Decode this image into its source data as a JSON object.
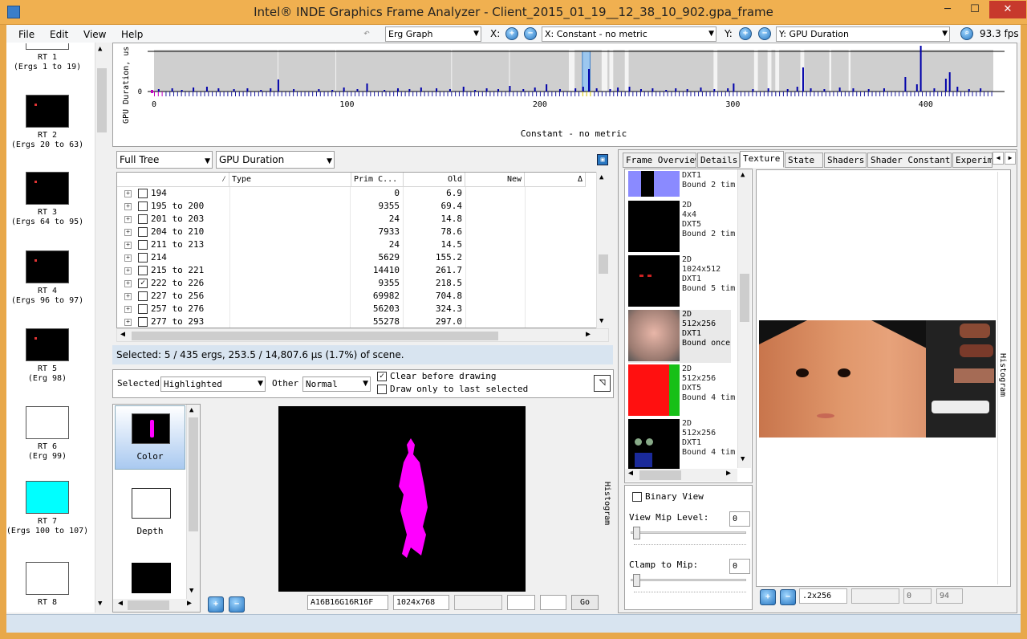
{
  "window": {
    "title": "Intel® INDE Graphics Frame Analyzer - Client_2015_01_19__12_38_10_902.gpa_frame",
    "min": "─",
    "max": "☐",
    "close": "✕"
  },
  "menu": [
    "File",
    "Edit",
    "View",
    "Help"
  ],
  "toolbar": {
    "graph_type": "Erg Graph",
    "x_label": "X:",
    "x_metric": "X: Constant - no metric",
    "y_label": "Y:",
    "y_metric": "Y: GPU Duration",
    "fps": "93.3 fps"
  },
  "chart_data": {
    "type": "bar",
    "ylabel": "GPU Duration, us",
    "xlabel": "Constant - no metric",
    "x_ticks": [
      0,
      100,
      200,
      300,
      400
    ],
    "y_ticks": [
      "0"
    ],
    "xlim": [
      0,
      435
    ],
    "highlight_range": [
      222,
      226
    ],
    "bars": [
      [
        2,
        3
      ],
      [
        9,
        4
      ],
      [
        14,
        2
      ],
      [
        20,
        5
      ],
      [
        27,
        6
      ],
      [
        33,
        4
      ],
      [
        41,
        3
      ],
      [
        48,
        4
      ],
      [
        55,
        2
      ],
      [
        60,
        4
      ],
      [
        64,
        15
      ],
      [
        72,
        3
      ],
      [
        85,
        3
      ],
      [
        92,
        2
      ],
      [
        98,
        5
      ],
      [
        105,
        3
      ],
      [
        110,
        10
      ],
      [
        119,
        2
      ],
      [
        126,
        4
      ],
      [
        132,
        3
      ],
      [
        138,
        5
      ],
      [
        146,
        4
      ],
      [
        153,
        3
      ],
      [
        160,
        6
      ],
      [
        166,
        2
      ],
      [
        172,
        4
      ],
      [
        178,
        3
      ],
      [
        184,
        7
      ],
      [
        191,
        3
      ],
      [
        197,
        5
      ],
      [
        203,
        9
      ],
      [
        210,
        3
      ],
      [
        218,
        4
      ],
      [
        222,
        6
      ],
      [
        225,
        28
      ],
      [
        229,
        4
      ],
      [
        236,
        3
      ],
      [
        240,
        5
      ],
      [
        246,
        6
      ],
      [
        252,
        3
      ],
      [
        258,
        4
      ],
      [
        265,
        2
      ],
      [
        270,
        4
      ],
      [
        276,
        3
      ],
      [
        283,
        5
      ],
      [
        290,
        3
      ],
      [
        297,
        4
      ],
      [
        300,
        10
      ],
      [
        310,
        3
      ],
      [
        318,
        4
      ],
      [
        328,
        3
      ],
      [
        333,
        6
      ],
      [
        336,
        30
      ],
      [
        340,
        4
      ],
      [
        347,
        3
      ],
      [
        355,
        5
      ],
      [
        362,
        4
      ],
      [
        370,
        3
      ],
      [
        378,
        4
      ],
      [
        389,
        18
      ],
      [
        395,
        9
      ],
      [
        397,
        57
      ],
      [
        404,
        4
      ],
      [
        410,
        16
      ],
      [
        412,
        24
      ],
      [
        416,
        6
      ],
      [
        422,
        3
      ],
      [
        428,
        4
      ]
    ]
  },
  "left_thumbs": [
    {
      "label": "RT 1\n(Ergs 1 to 19)",
      "kind": "white-partial"
    },
    {
      "label": "RT 2\n(Ergs 20 to 63)",
      "kind": "black"
    },
    {
      "label": "RT 3\n(Ergs 64 to 95)",
      "kind": "black"
    },
    {
      "label": "RT 4\n(Ergs 96 to 97)",
      "kind": "black"
    },
    {
      "label": "RT 5\n(Erg 98)",
      "kind": "black"
    },
    {
      "label": "RT 6\n(Erg 99)",
      "kind": "white"
    },
    {
      "label": "RT 7\n(Ergs 100 to 107)",
      "kind": "cyan"
    },
    {
      "label": "RT 8",
      "kind": "white"
    }
  ],
  "tree_panel": {
    "view": "Full Tree",
    "metric": "GPU Duration",
    "columns": [
      "Type",
      "Prim C...",
      "Old",
      "New",
      "Δ"
    ],
    "rows": [
      {
        "name": "194",
        "prim": "0",
        "old": "6.9",
        "checked": false
      },
      {
        "name": "195 to 200",
        "prim": "9355",
        "old": "69.4",
        "checked": false
      },
      {
        "name": "201 to 203",
        "prim": "24",
        "old": "14.8",
        "checked": false
      },
      {
        "name": "204 to 210",
        "prim": "7933",
        "old": "78.6",
        "checked": false
      },
      {
        "name": "211 to 213",
        "prim": "24",
        "old": "14.5",
        "checked": false
      },
      {
        "name": "214",
        "prim": "5629",
        "old": "155.2",
        "checked": false
      },
      {
        "name": "215 to 221",
        "prim": "14410",
        "old": "261.7",
        "checked": false
      },
      {
        "name": "222 to 226",
        "prim": "9355",
        "old": "218.5",
        "checked": true
      },
      {
        "name": "227 to 256",
        "prim": "69982",
        "old": "704.8",
        "checked": false
      },
      {
        "name": "257 to 276",
        "prim": "56203",
        "old": "324.3",
        "checked": false
      },
      {
        "name": "277 to 293",
        "prim": "55278",
        "old": "297.0",
        "checked": false
      }
    ],
    "status": "Selected: 5 / 435 ergs, 253.5 / 14,807.6 µs (1.7%) of scene."
  },
  "render_panel": {
    "selected_label": "Selected",
    "selected_mode": "Highlighted",
    "other_label": "Other",
    "other_mode": "Normal",
    "clear_before": "Clear before drawing",
    "draw_only_last": "Draw only to last selected",
    "targets": [
      {
        "label": "Color"
      },
      {
        "label": "Depth"
      }
    ],
    "format": "A16B16G16R16F",
    "size": "1024x768",
    "go": "Go",
    "histogram": "Histogram"
  },
  "right_tabs": [
    "Frame Overview",
    "Details",
    "Texture",
    "State",
    "Shaders",
    "Shader Constants",
    "Experim"
  ],
  "textures": [
    {
      "lines": [
        "DXT1",
        "Bound 2 tim"
      ],
      "kind": "blue"
    },
    {
      "lines": [
        "2D",
        "4x4",
        "DXT5",
        "Bound 2 tim"
      ],
      "kind": "black"
    },
    {
      "lines": [
        "2D",
        "1024x512",
        "DXT1",
        "Bound 5 tim"
      ],
      "kind": "eyes"
    },
    {
      "lines": [
        "2D",
        "512x256",
        "DXT1",
        "Bound once"
      ],
      "kind": "face",
      "selected": true
    },
    {
      "lines": [
        "2D",
        "512x256",
        "DXT5",
        "Bound 4 tim"
      ],
      "kind": "red"
    },
    {
      "lines": [
        "2D",
        "512x256",
        "DXT1",
        "Bound 4 tim"
      ],
      "kind": "dark"
    }
  ],
  "texture_opts": {
    "binary_view": "Binary View",
    "mip_label": "View Mip Level:",
    "mip_value": "0",
    "clamp_label": "Clamp to Mip:",
    "clamp_value": "0"
  },
  "preview_footer": {
    "size": ".2x256",
    "v1": "0",
    "v2": "94"
  },
  "colors": {
    "accent": "#f0b050",
    "bar": "#0000aa",
    "selection": "#0078d7"
  }
}
